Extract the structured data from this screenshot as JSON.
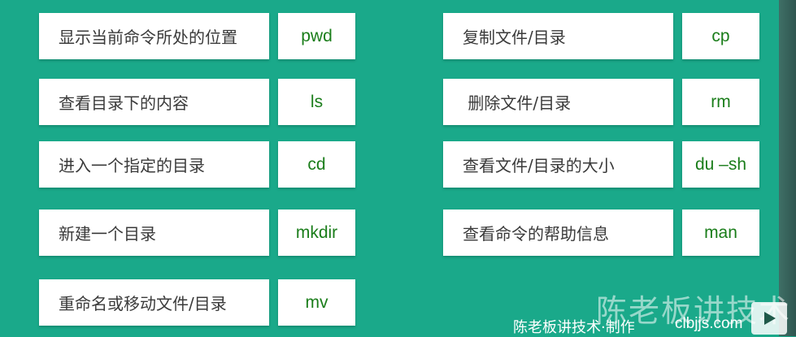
{
  "left_commands": [
    {
      "desc": "显示当前命令所处的位置",
      "cmd": "pwd"
    },
    {
      "desc": "查看目录下的内容",
      "cmd": "ls"
    },
    {
      "desc": "进入一个指定的目录",
      "cmd": "cd"
    },
    {
      "desc": "新建一个目录",
      "cmd": "mkdir"
    },
    {
      "desc": "重命名或移动文件/目录",
      "cmd": "mv"
    }
  ],
  "right_commands": [
    {
      "desc": "复制文件/目录",
      "cmd": "cp"
    },
    {
      "desc": " 删除文件/目录",
      "cmd": "rm"
    },
    {
      "desc": "查看文件/目录的大小",
      "cmd": "du –sh"
    },
    {
      "desc": "查看命令的帮助信息",
      "cmd": "man"
    }
  ],
  "watermark": {
    "title": "陈老板讲技术",
    "credit": "陈老板讲技术·制作",
    "url": "clbjjs.com"
  },
  "icons": {
    "play": "play-icon"
  },
  "colors": {
    "background": "#1aa98a",
    "command_text": "#1a7d1a",
    "card": "#ffffff"
  }
}
